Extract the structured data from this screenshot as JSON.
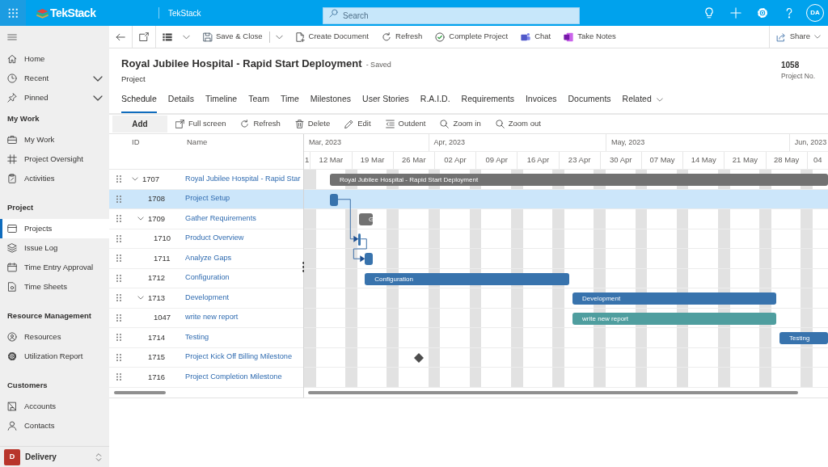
{
  "top_bar": {
    "logo": "TekStack",
    "app_name": "TekStack",
    "search": {
      "placeholder": "Search"
    },
    "avatar": "DA"
  },
  "sidebar": {
    "nav": [
      {
        "label": "Home",
        "kind": "link",
        "selected": false
      },
      {
        "label": "Recent",
        "kind": "flyout",
        "selected": false
      },
      {
        "label": "Pinned",
        "kind": "flyout",
        "selected": false
      }
    ],
    "sections": [
      {
        "title": "My Work",
        "items": [
          {
            "label": "My Work",
            "selected": false
          },
          {
            "label": "Project Oversight",
            "selected": false
          },
          {
            "label": "Activities",
            "selected": false
          }
        ]
      },
      {
        "title": "Project",
        "items": [
          {
            "label": "Projects",
            "selected": true
          },
          {
            "label": "Issue Log",
            "selected": false
          },
          {
            "label": "Time Entry Approval",
            "selected": false
          },
          {
            "label": "Time Sheets",
            "selected": false
          }
        ]
      },
      {
        "title": "Resource Management",
        "items": [
          {
            "label": "Resources",
            "selected": false
          },
          {
            "label": "Utilization Report",
            "selected": false
          }
        ]
      },
      {
        "title": "Customers",
        "items": [
          {
            "label": "Accounts",
            "selected": false
          },
          {
            "label": "Contacts",
            "selected": false
          }
        ]
      }
    ],
    "area": {
      "badge": "D",
      "label": "Delivery"
    }
  },
  "command_bar": {
    "items": [
      {
        "kind": "icon"
      },
      {
        "kind": "icon"
      },
      {
        "kind": "menu"
      },
      {
        "kind": "split",
        "label": "Save & Close"
      },
      {
        "kind": "button",
        "label": "Create Document"
      },
      {
        "kind": "button",
        "label": "Refresh"
      },
      {
        "kind": "button",
        "label": "Complete Project"
      },
      {
        "kind": "button",
        "label": "Chat"
      },
      {
        "kind": "button",
        "label": "Take Notes"
      }
    ],
    "share": {
      "label": "Share"
    }
  },
  "record": {
    "title": "Royal Jubilee Hospital - Rapid Start Deployment",
    "save_status": "- Saved",
    "entity": "Project",
    "field": {
      "value": "1058",
      "label": "Project No."
    }
  },
  "tabs": [
    {
      "label": "Schedule",
      "kind": "tab",
      "selected": true
    },
    {
      "label": "Details",
      "kind": "tab",
      "selected": false
    },
    {
      "label": "Timeline",
      "kind": "tab",
      "selected": false
    },
    {
      "label": "Team",
      "kind": "tab",
      "selected": false
    },
    {
      "label": "Time",
      "kind": "tab",
      "selected": false
    },
    {
      "label": "Milestones",
      "kind": "tab",
      "selected": false
    },
    {
      "label": "User Stories",
      "kind": "tab",
      "selected": false
    },
    {
      "label": "R.A.I.D.",
      "kind": "tab",
      "selected": false
    },
    {
      "label": "Requirements",
      "kind": "tab",
      "selected": false
    },
    {
      "label": "Invoices",
      "kind": "tab",
      "selected": false
    },
    {
      "label": "Documents",
      "kind": "tab",
      "selected": false
    },
    {
      "label": "Related",
      "kind": "menu",
      "selected": false
    }
  ],
  "gantt": {
    "toolbar": [
      {
        "label": "Add",
        "kind": "primary"
      },
      {
        "label": "Full screen",
        "kind": "tool"
      },
      {
        "label": "Refresh",
        "kind": "tool"
      },
      {
        "label": "Delete",
        "kind": "tool"
      },
      {
        "label": "Edit",
        "kind": "tool"
      },
      {
        "label": "Outdent",
        "kind": "tool"
      },
      {
        "label": "Zoom in",
        "kind": "tool"
      },
      {
        "label": "Zoom out",
        "kind": "tool"
      }
    ],
    "columns": [
      "ID",
      "Name"
    ],
    "timeline": {
      "months": [
        "Mar, 2023",
        "Apr, 2023",
        "May, 2023",
        "Jun, 2023"
      ],
      "weeks": [
        "1",
        "12 Mar",
        "19 Mar",
        "26 Mar",
        "02 Apr",
        "09 Apr",
        "16 Apr",
        "23 Apr",
        "30 Apr",
        "07 May",
        "14 May",
        "21 May",
        "28 May",
        "04"
      ]
    },
    "tasks": [
      {
        "id": "1707",
        "name": "Royal Jubilee Hospital - Rapid Star",
        "selected": false,
        "expanded": true,
        "bar": {
          "kind": "summary",
          "color": "#717171",
          "label": "Royal Jubilee Hospital - Rapid Start Deployment"
        },
        "children": [
          {
            "id": "1708",
            "name": "Project Setup",
            "selected": true,
            "bar": {
              "kind": "task",
              "color": "#3873ad"
            }
          },
          {
            "id": "1709",
            "name": "Gather Requirements",
            "selected": false,
            "expanded": true,
            "bar": {
              "kind": "summary",
              "color": "#717171",
              "label": "G"
            },
            "children": [
              {
                "id": "1710",
                "name": "Product Overview",
                "selected": false,
                "bar": {
                  "kind": "task",
                  "color": "#3873ad"
                }
              },
              {
                "id": "1711",
                "name": "Analyze Gaps",
                "selected": false,
                "bar": {
                  "kind": "task",
                  "color": "#3873ad"
                }
              }
            ]
          },
          {
            "id": "1712",
            "name": "Configuration",
            "selected": false,
            "bar": {
              "kind": "task",
              "color": "#3873ad",
              "label": "Configuration"
            }
          },
          {
            "id": "1713",
            "name": "Development",
            "selected": false,
            "expanded": true,
            "bar": {
              "kind": "task",
              "color": "#3873ad",
              "label": "Development"
            },
            "children": [
              {
                "id": "1047",
                "name": "write new report",
                "selected": false,
                "bar": {
                  "kind": "task",
                  "color": "#4f9e9f",
                  "label": "write new report"
                }
              }
            ]
          },
          {
            "id": "1714",
            "name": "Testing",
            "selected": false,
            "bar": {
              "kind": "task",
              "color": "#3873ad",
              "label": "Testing"
            }
          },
          {
            "id": "1715",
            "name": "Project Kick Off Billing Milestone",
            "selected": false,
            "bar": {
              "kind": "milestone",
              "color": "#4d4d4d"
            }
          },
          {
            "id": "1716",
            "name": "Project Completion Milestone",
            "selected": false
          }
        ]
      }
    ]
  }
}
